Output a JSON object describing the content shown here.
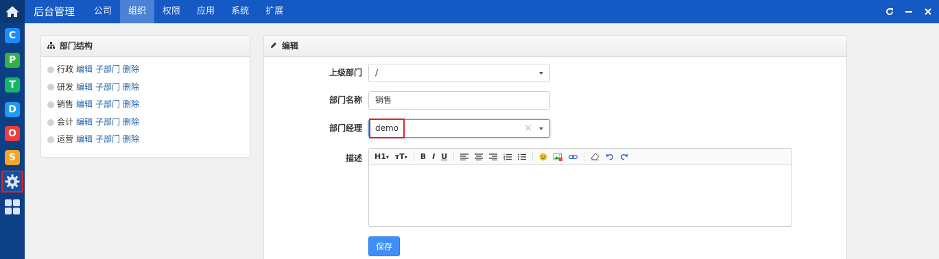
{
  "topbar": {
    "brand": "后台管理",
    "nav": [
      "公司",
      "组织",
      "权限",
      "应用",
      "系统",
      "扩展"
    ],
    "active_nav": "组织",
    "color": "#1559c4"
  },
  "sidebar": {
    "apps": [
      {
        "letter": "C",
        "color": "#1a8cff"
      },
      {
        "letter": "P",
        "color": "#2fb344"
      },
      {
        "letter": "T",
        "color": "#12b76a"
      },
      {
        "letter": "D",
        "color": "#1e9bf0"
      },
      {
        "letter": "O",
        "color": "#f03c3c"
      },
      {
        "letter": "S",
        "color": "#f5a623"
      }
    ],
    "icons": [
      "home-icon",
      "gear-icon",
      "grid-icon"
    ]
  },
  "dept_panel": {
    "title": "部门结构",
    "items": [
      {
        "name": "行政",
        "edit": "编辑",
        "sub": "子部门",
        "del": "删除"
      },
      {
        "name": "研发",
        "edit": "编辑",
        "sub": "子部门",
        "del": "删除"
      },
      {
        "name": "销售",
        "edit": "编辑",
        "sub": "子部门",
        "del": "删除"
      },
      {
        "name": "会计",
        "edit": "编辑",
        "sub": "子部门",
        "del": "删除"
      },
      {
        "name": "运营",
        "edit": "编辑",
        "sub": "子部门",
        "del": "删除"
      }
    ]
  },
  "edit_panel": {
    "title": "编辑",
    "parent_label": "上级部门",
    "parent_value": "/",
    "name_label": "部门名称",
    "name_value": "销售",
    "manager_label": "部门经理",
    "manager_value": "demo",
    "manager_clear": "×",
    "desc_label": "描述",
    "toolbar": [
      "H1",
      "тT",
      "B",
      "I",
      "U",
      "align-left",
      "align-center",
      "align-right",
      "ordered-list",
      "unordered-list",
      "emoticon",
      "image",
      "link",
      "eraser",
      "undo",
      "redo"
    ],
    "save_label": "保存"
  }
}
